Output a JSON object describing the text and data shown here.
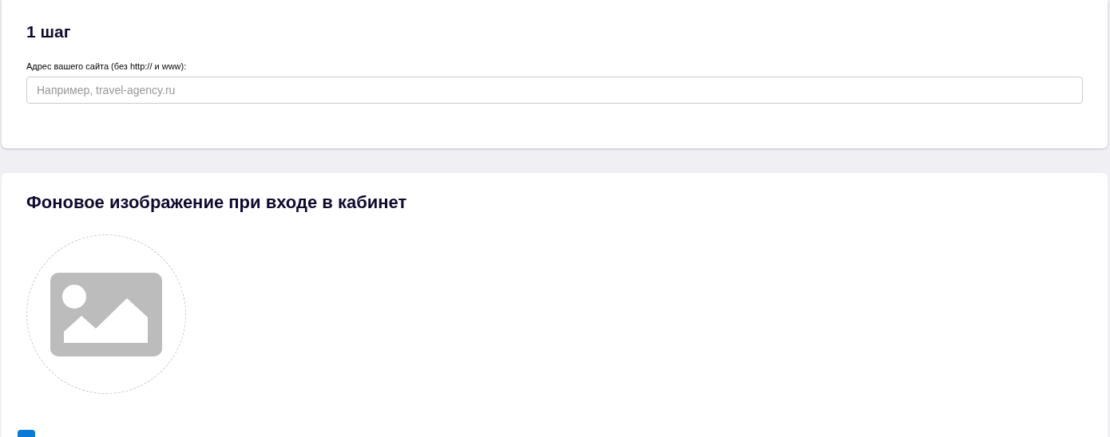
{
  "step_card": {
    "title": "1 шаг",
    "site_field": {
      "label": "Адрес вашего сайта (без http:// и www):",
      "placeholder": "Например, travel-agency.ru"
    }
  },
  "background_card": {
    "title": "Фоновое изображение при входе в кабинет"
  }
}
